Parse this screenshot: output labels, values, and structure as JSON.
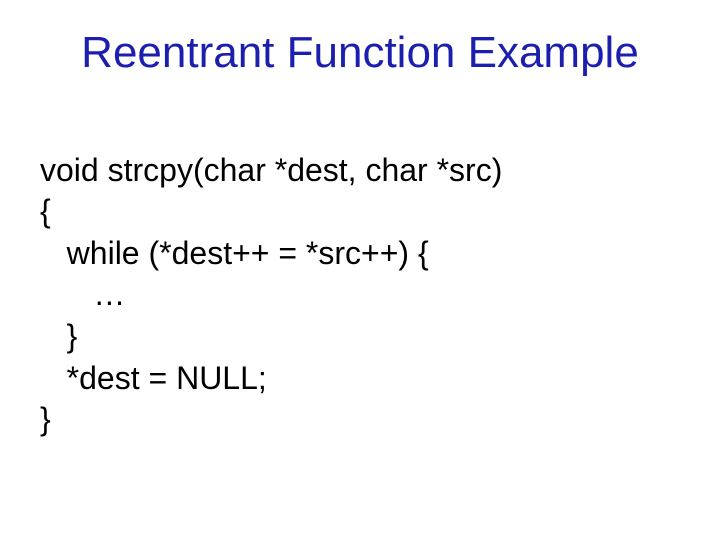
{
  "title": "Reentrant Function Example",
  "code": {
    "l1": "void strcpy(char *dest, char *src)",
    "l2": "{",
    "l3": "   while (*dest++ = *src++) {",
    "l4": "      …",
    "l5": "   }",
    "l6": "   *dest = NULL;",
    "l7": "}"
  }
}
